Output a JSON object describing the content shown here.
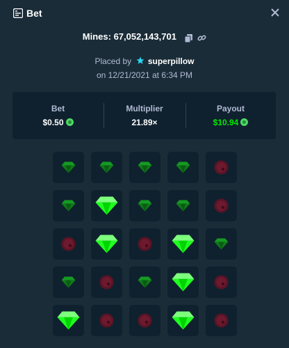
{
  "header": {
    "title": "Bet",
    "icon": "bet-slip-icon",
    "close_icon": "close-icon"
  },
  "mines": {
    "label": "Mines: 67,052,143,701",
    "copy_icon": "copy-icon",
    "link_icon": "link-icon"
  },
  "placed": {
    "prefix": "Placed by",
    "user": "superpillow",
    "user_icon": "vip-star-icon"
  },
  "date": "on 12/21/2021 at 6:34 PM",
  "stats": {
    "bet": {
      "label": "Bet",
      "value": "$0.50",
      "icon": "coin-icon"
    },
    "multiplier": {
      "label": "Multiplier",
      "value": "21.89×"
    },
    "payout": {
      "label": "Payout",
      "value": "$10.94",
      "icon": "coin-icon",
      "color": "#00e701"
    }
  },
  "board": {
    "rows": [
      [
        "gem-dim",
        "gem-dim",
        "gem-dim",
        "gem-dim",
        "mine-dim"
      ],
      [
        "gem-dim",
        "gem",
        "gem-dim",
        "gem-dim",
        "mine-dim"
      ],
      [
        "mine-dim",
        "gem",
        "mine-dim",
        "gem",
        "gem-dim"
      ],
      [
        "gem-dim",
        "mine-dim",
        "gem-dim",
        "gem",
        "mine-dim"
      ],
      [
        "gem",
        "mine-dim",
        "mine-dim",
        "gem",
        "mine-dim"
      ]
    ]
  }
}
